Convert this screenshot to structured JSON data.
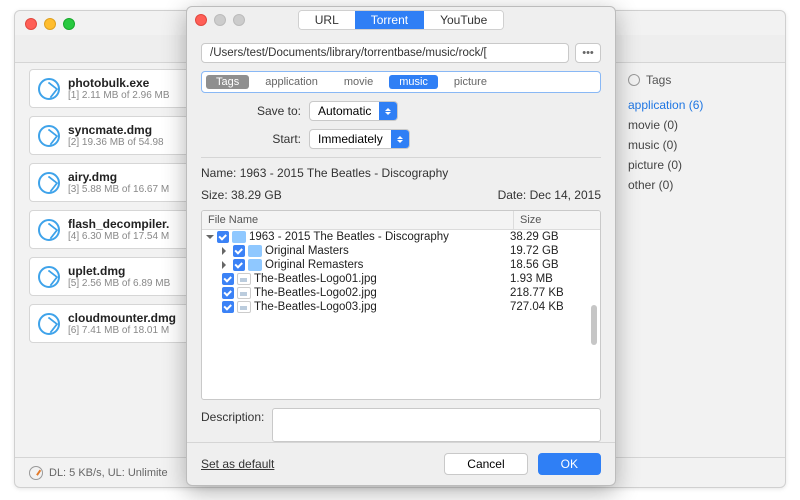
{
  "back": {
    "downloads": [
      {
        "name": "photobulk.exe",
        "idx": "1",
        "meta": "2.11 MB of 2.96 MB"
      },
      {
        "name": "syncmate.dmg",
        "idx": "2",
        "meta": "19.36 MB of 54.98"
      },
      {
        "name": "airy.dmg",
        "idx": "3",
        "meta": "5.88 MB of 16.67 M"
      },
      {
        "name": "flash_decompiler.",
        "idx": "4",
        "meta": "6.30 MB of 17.54 M"
      },
      {
        "name": "uplet.dmg",
        "idx": "5",
        "meta": "2.56 MB of 6.89 MB"
      },
      {
        "name": "cloudmounter.dmg",
        "idx": "6",
        "meta": "7.41 MB of 18.01 M"
      }
    ],
    "tags": {
      "heading": "Tags",
      "items": [
        {
          "label": "application  (6)",
          "selected": true
        },
        {
          "label": "movie  (0)"
        },
        {
          "label": "music  (0)"
        },
        {
          "label": "picture  (0)"
        },
        {
          "label": "other  (0)"
        }
      ]
    },
    "status": "DL: 5 KB/s, UL: Unlimite"
  },
  "dialog": {
    "tabs": {
      "url": "URL",
      "torrent": "Torrent",
      "youtube": "YouTube"
    },
    "path": "/Users/test/Documents/library/torrentbase/music/rock/[",
    "path_button": "•••",
    "tagchips": {
      "label": "Tags",
      "application": "application",
      "movie": "movie",
      "music": "music",
      "picture": "picture"
    },
    "form": {
      "saveto_label": "Save to:",
      "saveto_value": "Automatic",
      "start_label": "Start:",
      "start_value": "Immediately"
    },
    "meta": {
      "name_label": "Name:",
      "name": "1963 - 2015 The Beatles - Discography",
      "size_label": "Size:",
      "size": "38.29 GB",
      "date_label": "Date:",
      "date": "Dec 14, 2015"
    },
    "table": {
      "col_name": "File Name",
      "col_size": "Size",
      "rows": [
        {
          "name": "1963 - 2015 The Beatles - Discography",
          "size": "38.29 GB",
          "level": 1,
          "type": "folder",
          "disclosure": "down"
        },
        {
          "name": "Original Masters",
          "size": "19.72 GB",
          "level": 2,
          "type": "folder",
          "disclosure": "right"
        },
        {
          "name": "Original Remasters",
          "size": "18.56 GB",
          "level": 2,
          "type": "folder",
          "disclosure": "right"
        },
        {
          "name": "The-Beatles-Logo01.jpg",
          "size": "1.93 MB",
          "level": 2,
          "type": "file"
        },
        {
          "name": "The-Beatles-Logo02.jpg",
          "size": "218.77 KB",
          "level": 2,
          "type": "file"
        },
        {
          "name": "The-Beatles-Logo03.jpg",
          "size": "727.04 KB",
          "level": 2,
          "type": "file"
        }
      ]
    },
    "description_label": "Description:",
    "footer": {
      "set_default": "Set as default",
      "cancel": "Cancel",
      "ok": "OK"
    }
  }
}
